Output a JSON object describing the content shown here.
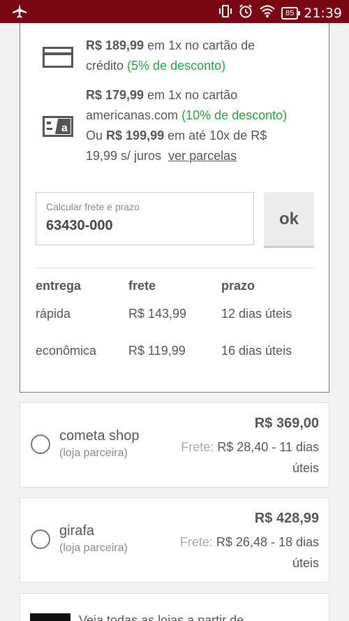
{
  "status_bar": {
    "time": "21:39",
    "battery": "85"
  },
  "payment": {
    "credit": {
      "price": "R$ 189,99",
      "text": "em 1x no cartão de",
      "line2": "crédito",
      "discount": "(5% de desconto)"
    },
    "americanas": {
      "price": "R$ 179,99",
      "text": "em 1x no cartão",
      "line2": "americanas.com",
      "discount": "(10% de desconto)",
      "or": "Ou",
      "price2": "R$ 199,99",
      "text2": "em até 10x de R$",
      "line4": "19,99 s/ juros",
      "link": "ver parcelas"
    }
  },
  "freight": {
    "label": "Calcular frete e prazo",
    "value": "63430-000",
    "button": "ok"
  },
  "shipping": {
    "headers": [
      "entrega",
      "frete",
      "prazo"
    ],
    "rows": [
      [
        "rápida",
        "R$ 143,99",
        "12 dias úteis"
      ],
      [
        "econômica",
        "R$ 119,99",
        "16 dias úteis"
      ]
    ]
  },
  "sellers": [
    {
      "name": "cometa shop",
      "sub": "(loja parceira)",
      "price": "R$ 369,00",
      "frete_label": "Frete:",
      "frete": "R$ 28,40 - 11 dias úteis"
    },
    {
      "name": "girafa",
      "sub": "(loja parceira)",
      "price": "R$ 428,99",
      "frete_label": "Frete:",
      "frete": "R$ 26,48 - 18 dias úteis"
    }
  ],
  "bottom": {
    "text": "Veja todas as lojas a partir de"
  }
}
